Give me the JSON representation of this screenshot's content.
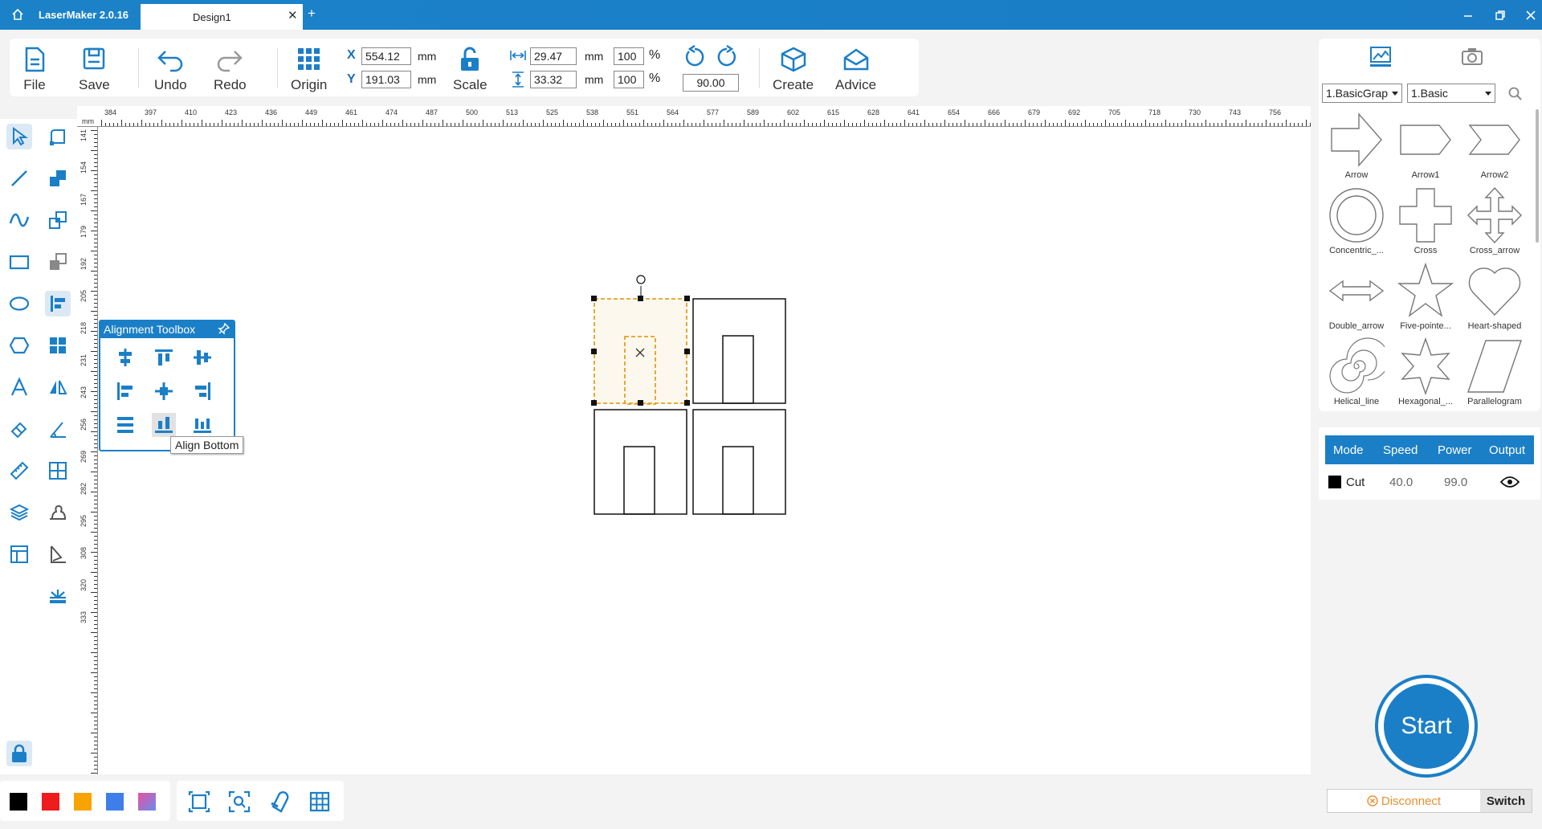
{
  "titlebar": {
    "app_name": "LaserMaker 2.0.16",
    "tab_label": "Design1",
    "close_tab": "✕",
    "add_tab": "+"
  },
  "toolbar": {
    "file": "File",
    "save": "Save",
    "undo": "Undo",
    "redo": "Redo",
    "origin": "Origin",
    "x_label": "X",
    "y_label": "Y",
    "x_value": "554.12",
    "y_value": "191.03",
    "unit": "mm",
    "scale": "Scale",
    "width_value": "29.47",
    "height_value": "33.32",
    "width_pct": "100",
    "height_pct": "100",
    "pct": "%",
    "rotation_value": "90.00",
    "create": "Create",
    "advice": "Advice"
  },
  "ruler": {
    "unit": "mm",
    "top_ticks": [
      "384",
      "397",
      "410",
      "423",
      "436",
      "449",
      "461",
      "474",
      "487",
      "500",
      "513",
      "525",
      "538",
      "551",
      "564",
      "577",
      "589",
      "602",
      "615",
      "628",
      "641",
      "654",
      "666",
      "679",
      "692",
      "705",
      "718",
      "730",
      "743",
      "756"
    ],
    "left_ticks": [
      "141",
      "154",
      "167",
      "179",
      "192",
      "205",
      "218",
      "231",
      "243",
      "256",
      "269",
      "282",
      "295",
      "308",
      "320",
      "333"
    ]
  },
  "alignment_toolbox": {
    "title": "Alignment Toolbox",
    "tooltip": "Align Bottom"
  },
  "library": {
    "category": "1.BasicGrap",
    "subcategory": "1.Basic",
    "shapes": [
      "Arrow",
      "Arrow1",
      "Arrow2",
      "Concentric_...",
      "Cross",
      "Cross_arrow",
      "Double_arrow",
      "Five-pointe...",
      "Heart-shaped",
      "Helical_line",
      "Hexagonal_...",
      "Parallelogram"
    ]
  },
  "layers": {
    "headers": [
      "Mode",
      "Speed",
      "Power",
      "Output"
    ],
    "rows": [
      {
        "color": "#000000",
        "mode": "Cut",
        "speed": "40.0",
        "power": "99.0"
      }
    ]
  },
  "palette": [
    "#000000",
    "#ee1c1c",
    "#f7a400",
    "#3e7ee8",
    "#e84fa0"
  ],
  "device": {
    "start": "Start",
    "disconnect": "Disconnect",
    "switch": "Switch"
  }
}
